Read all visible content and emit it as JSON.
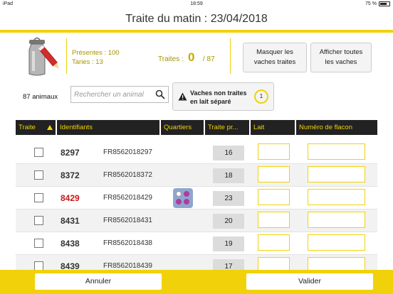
{
  "statusbar": {
    "device": "iPad",
    "time": "18:59",
    "battery_text": "75 %",
    "battery_level": 0.75
  },
  "header": {
    "title": "Traite du matin : 23/04/2018"
  },
  "stats": {
    "presentes": "Présentes : 100",
    "taries": "Taries : 13",
    "traites_label": "Traites :",
    "traites_value": "0",
    "traites_total": "/ 87"
  },
  "buttons": {
    "masquer_line1": "Masquer les",
    "masquer_line2": "vaches traites",
    "afficher_line1": "Afficher toutes",
    "afficher_line2": "les vaches"
  },
  "toolbar": {
    "count": "87 animaux",
    "search_placeholder": "Rechercher un animal",
    "warn_line1": "Vaches non traites",
    "warn_line2": "en lait séparé",
    "warn_count": "1"
  },
  "table": {
    "columns": [
      "Traite",
      "Identifiants",
      "Quartiers",
      "Traite pr...",
      "Lait",
      "Numéro de flacon"
    ],
    "rows": [
      {
        "num": "8297",
        "id": "FR8562018297",
        "tp": "16",
        "highlight": false,
        "quartiers": false
      },
      {
        "num": "8372",
        "id": "FR8562018372",
        "tp": "18",
        "highlight": false,
        "quartiers": false
      },
      {
        "num": "8429",
        "id": "FR8562018429",
        "tp": "23",
        "highlight": true,
        "quartiers": true
      },
      {
        "num": "8431",
        "id": "FR8562018431",
        "tp": "20",
        "highlight": false,
        "quartiers": false
      },
      {
        "num": "8438",
        "id": "FR8562018438",
        "tp": "19",
        "highlight": false,
        "quartiers": false
      },
      {
        "num": "8439",
        "id": "FR8562018439",
        "tp": "17",
        "highlight": false,
        "quartiers": false
      }
    ]
  },
  "footer": {
    "cancel": "Annuler",
    "validate": "Valider"
  },
  "colors": {
    "accent": "#f1d20a",
    "header_bg": "#222222",
    "highlight": "#c8171c"
  }
}
